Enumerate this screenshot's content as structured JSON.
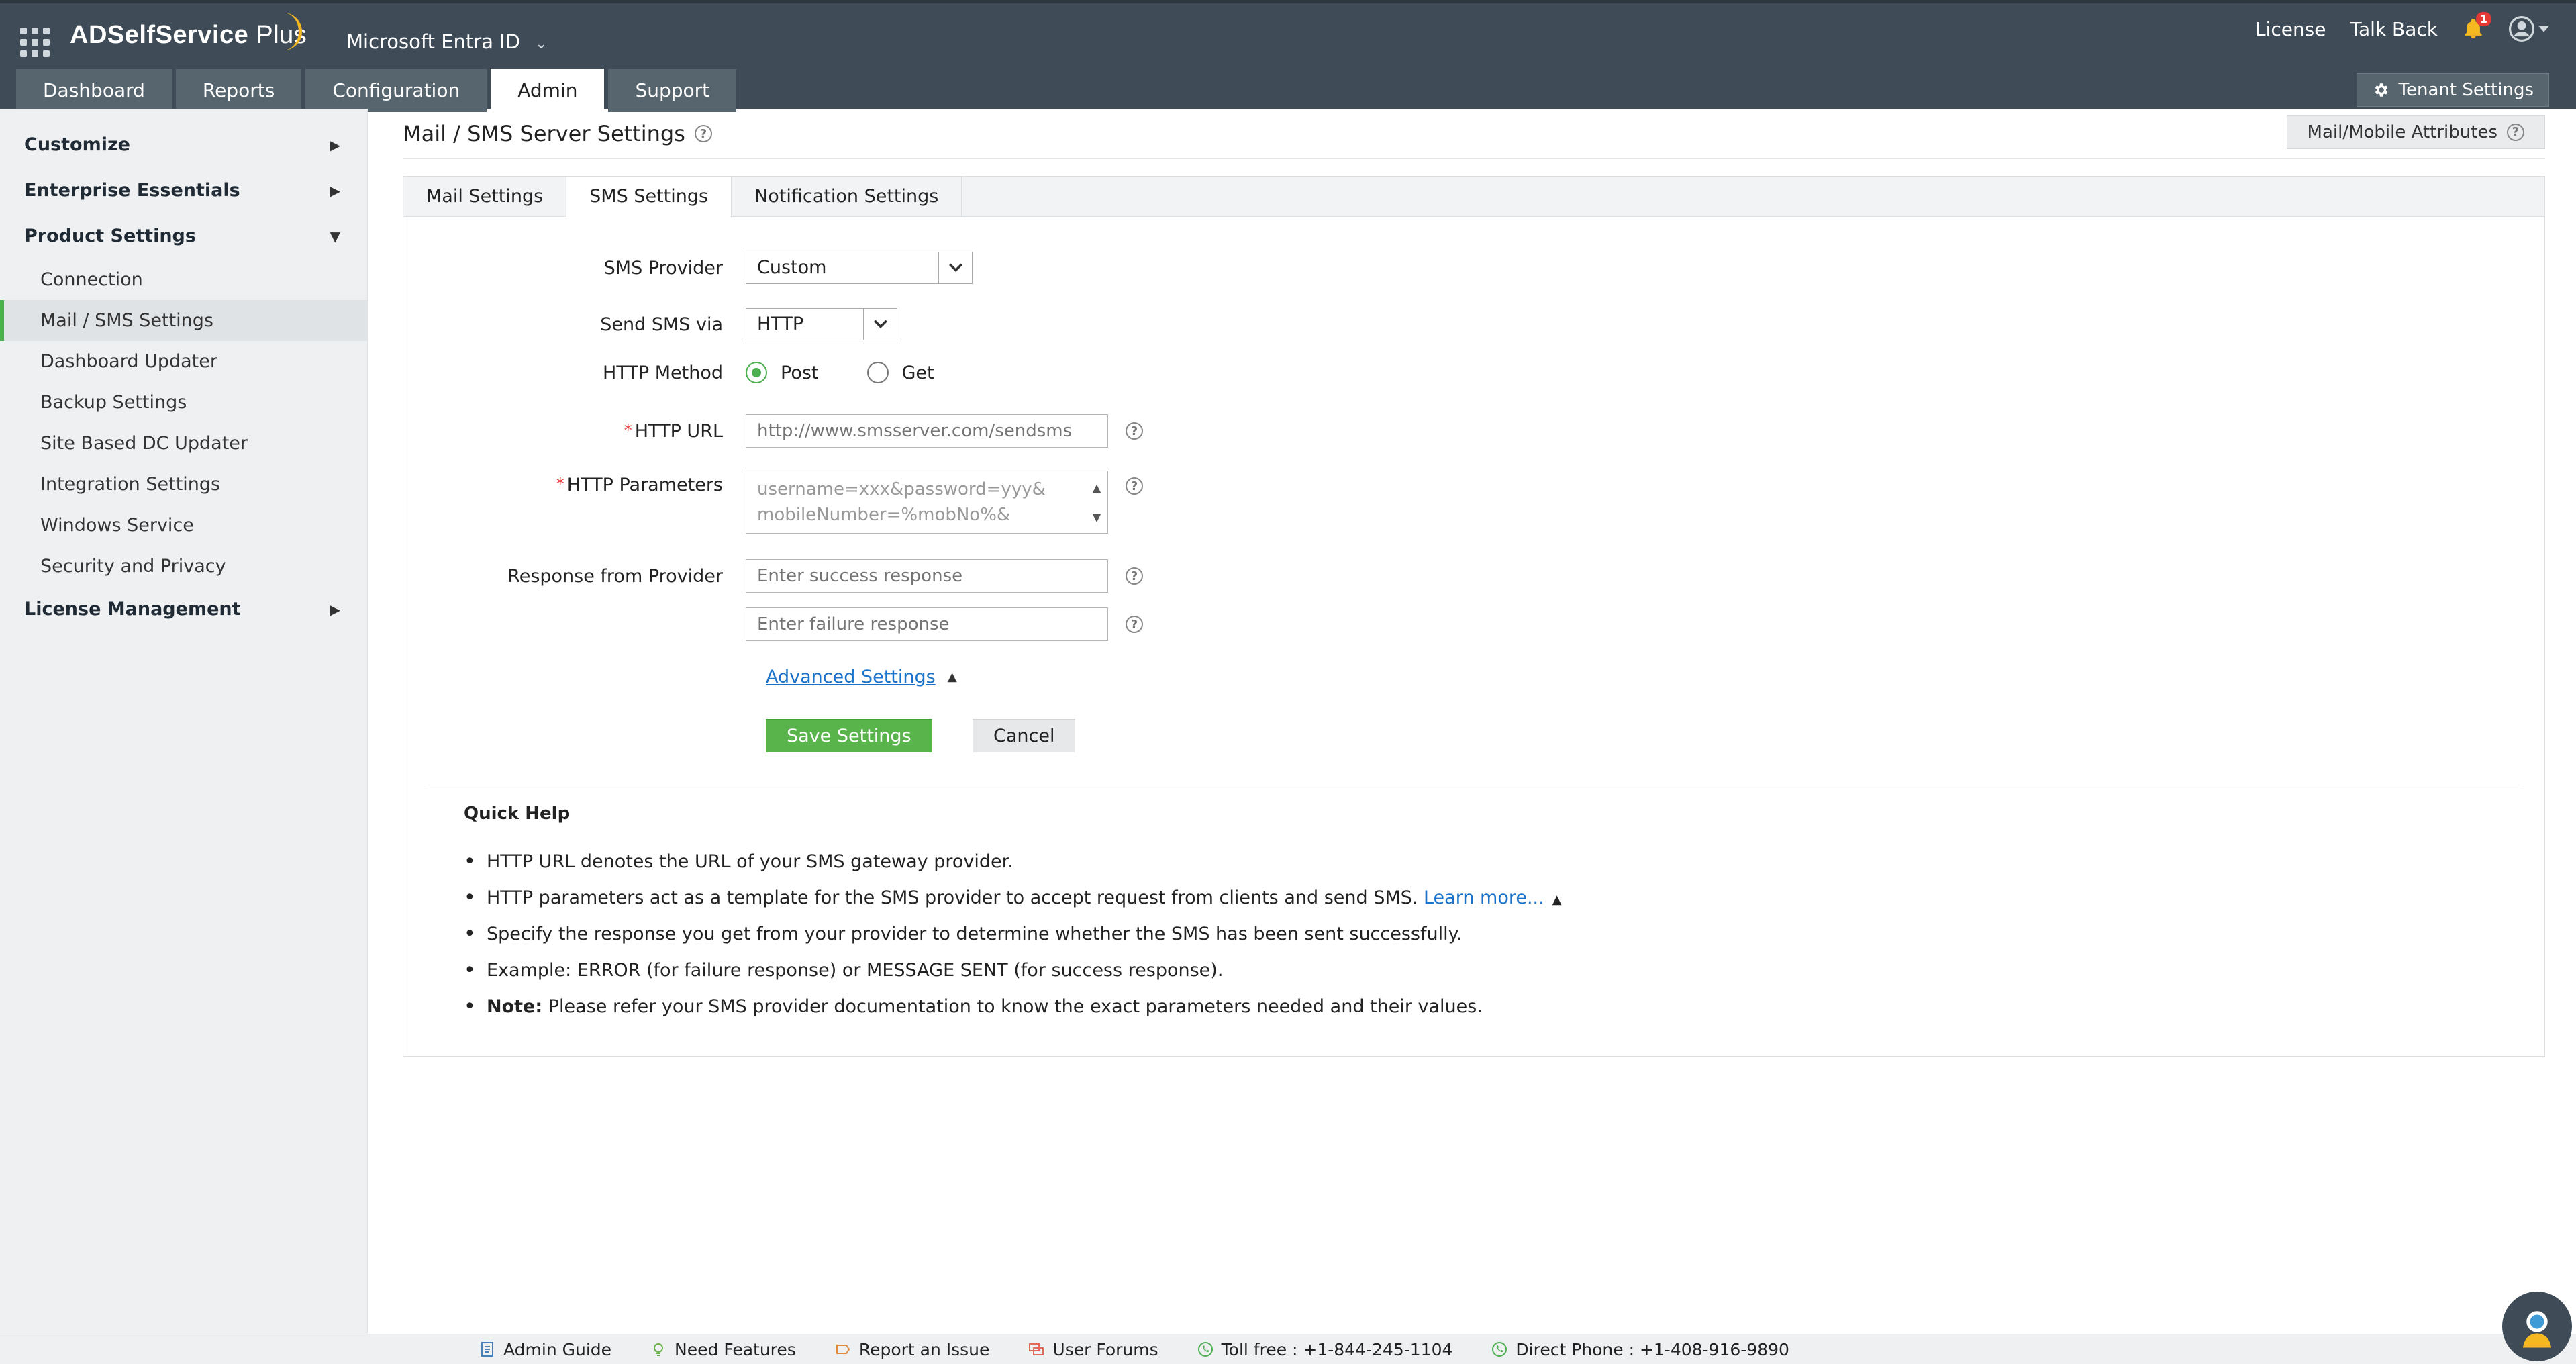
{
  "header": {
    "app_name": "ADSelfService Plus",
    "app_name_main": "ADSelfService",
    "app_name_suffix": " Plus",
    "tenant": "Microsoft Entra ID",
    "links": {
      "license": "License",
      "talk_back": "Talk Back"
    },
    "notification_count": "1",
    "tabs": [
      {
        "label": "Dashboard",
        "active": false
      },
      {
        "label": "Reports",
        "active": false
      },
      {
        "label": "Configuration",
        "active": false
      },
      {
        "label": "Admin",
        "active": true
      },
      {
        "label": "Support",
        "active": false
      }
    ],
    "tenant_settings": "Tenant Settings"
  },
  "sidebar": {
    "sections": {
      "customize": "Customize",
      "enterprise": "Enterprise Essentials",
      "product": "Product Settings",
      "license": "License Management"
    },
    "items": [
      {
        "label": "Connection",
        "active": false
      },
      {
        "label": "Mail / SMS Settings",
        "active": true
      },
      {
        "label": "Dashboard Updater",
        "active": false
      },
      {
        "label": "Backup Settings",
        "active": false
      },
      {
        "label": "Site Based DC Updater",
        "active": false
      },
      {
        "label": "Integration Settings",
        "active": false
      },
      {
        "label": "Windows Service",
        "active": false
      },
      {
        "label": "Security and Privacy",
        "active": false
      }
    ]
  },
  "main": {
    "title": "Mail / SMS Server Settings",
    "attributes_button": "Mail/Mobile Attributes",
    "tabs": [
      {
        "label": "Mail Settings",
        "active": false
      },
      {
        "label": "SMS Settings",
        "active": true
      },
      {
        "label": "Notification Settings",
        "active": false
      }
    ],
    "form": {
      "sms_provider_label": "SMS Provider",
      "sms_provider_value": "Custom",
      "send_via_label": "Send SMS via",
      "send_via_value": "HTTP",
      "http_method_label": "HTTP Method",
      "method_post": "Post",
      "method_get": "Get",
      "method_selected": "Post",
      "http_url_label": "HTTP URL",
      "http_url_placeholder": "http://www.smsserver.com/sendsms",
      "http_params_label": "HTTP Parameters",
      "http_params_line1": "username=xxx&password=yyy&",
      "http_params_line2": "mobileNumber=%mobNo%&",
      "response_label": "Response from Provider",
      "success_placeholder": "Enter success response",
      "failure_placeholder": "Enter failure response",
      "advanced_settings": "Advanced Settings",
      "save": "Save Settings",
      "cancel": "Cancel"
    },
    "quick_help": {
      "title": "Quick Help",
      "item1": "HTTP URL denotes the URL of your SMS gateway provider.",
      "item2": "HTTP parameters act as a template for the SMS provider to accept request from clients and send SMS. ",
      "item2_link": "Learn more...",
      "item3": "Specify the response you get from your provider to determine whether the SMS has been sent successfully.",
      "item4": "Example: ERROR (for failure response) or MESSAGE SENT (for success response).",
      "item5_bold": "Note:",
      "item5": " Please refer your SMS provider documentation to know the exact parameters needed and their values."
    }
  },
  "footer": {
    "admin_guide": "Admin Guide",
    "need_features": "Need Features",
    "report_issue": "Report an Issue",
    "user_forums": "User Forums",
    "toll_free": "Toll free : +1-844-245-1104",
    "direct_phone": "Direct Phone : +1-408-916-9890"
  },
  "colors": {
    "header_bg": "#3f4c57",
    "accent_green": "#58b44b",
    "link_blue": "#1a73c9",
    "required_red": "#e53935"
  }
}
